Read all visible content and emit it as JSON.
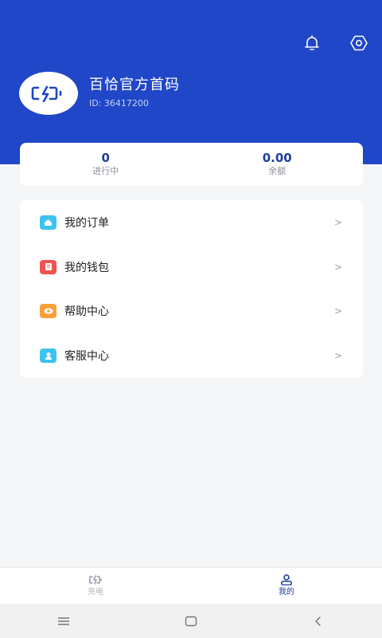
{
  "header": {
    "notification_icon": "bell-icon",
    "settings_icon": "gear-icon",
    "bg_color": "#1f47c7"
  },
  "profile": {
    "name": "百恰官方首码",
    "id_text": "ID:  36417200",
    "avatar_icon": "charger-logo-icon"
  },
  "stats": [
    {
      "value": "0",
      "label": "进行中"
    },
    {
      "value": "0.00",
      "label": "余额"
    }
  ],
  "menu": {
    "arrow": ">",
    "items": [
      {
        "label": "我的订单",
        "icon": "order-icon",
        "color": "#3dc3ef"
      },
      {
        "label": "我的钱包",
        "icon": "wallet-icon",
        "color": "#ef5350"
      },
      {
        "label": "帮助中心",
        "icon": "help-icon",
        "color": "#f7a13a"
      },
      {
        "label": "客服中心",
        "icon": "customer-service-icon",
        "color": "#3dc3ef"
      }
    ]
  },
  "tabbar": {
    "tabs": [
      {
        "label": "充电",
        "icon": "charge-icon",
        "active": false
      },
      {
        "label": "我的",
        "icon": "profile-icon",
        "active": true
      }
    ],
    "active_color": "#1f3f9a"
  },
  "system_nav": [
    "menu-icon",
    "home-icon",
    "back-icon"
  ]
}
